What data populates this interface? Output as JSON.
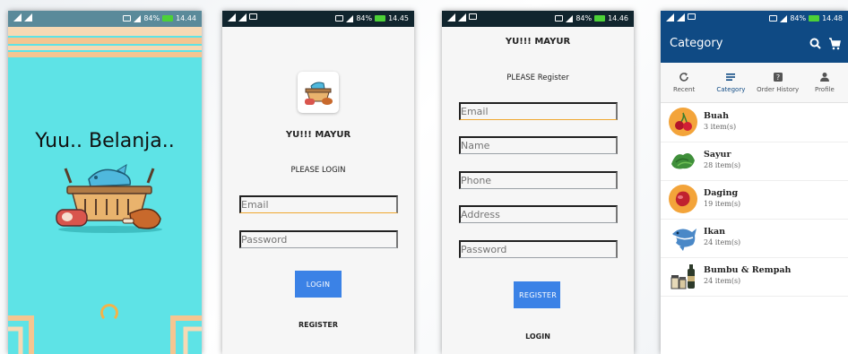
{
  "status_bar": {
    "battery": "84%",
    "times": [
      "14.44",
      "14.45",
      "14.46",
      "14.48"
    ]
  },
  "splash": {
    "title": "Yuu.. Belanja..",
    "colors": {
      "background": "#5ee3e6",
      "accent": "#f3b34a"
    }
  },
  "login": {
    "app_name": "YU!!! MAYUR",
    "heading": "PLEASE LOGIN",
    "email_placeholder": "Email",
    "password_placeholder": "Password",
    "login_button": "LOGIN",
    "register_link": "REGISTER"
  },
  "register": {
    "app_name": "YU!!! MAYUR",
    "heading": "PLEASE Register",
    "fields": {
      "email": "Email",
      "name": "Name",
      "phone": "Phone",
      "address": "Address",
      "password": "Password"
    },
    "register_button": "REGISTER",
    "login_link": "LOGIN"
  },
  "category": {
    "title": "Category",
    "tabs": [
      {
        "label": "Recent",
        "icon": "refresh-icon"
      },
      {
        "label": "Category",
        "icon": "list-icon"
      },
      {
        "label": "Order History",
        "icon": "help-box-icon"
      },
      {
        "label": "Profile",
        "icon": "person-icon"
      }
    ],
    "items": [
      {
        "name": "Buah",
        "count": "3 item(s)",
        "icon": "cherry-icon"
      },
      {
        "name": "Sayur",
        "count": "28 item(s)",
        "icon": "greens-icon"
      },
      {
        "name": "Daging",
        "count": "19 item(s)",
        "icon": "meat-icon"
      },
      {
        "name": "Ikan",
        "count": "24 item(s)",
        "icon": "fish-icon"
      },
      {
        "name": "Bumbu & Rempah",
        "count": "24 item(s)",
        "icon": "spice-jars-icon"
      }
    ],
    "colors": {
      "primary": "#0f4a84"
    }
  }
}
